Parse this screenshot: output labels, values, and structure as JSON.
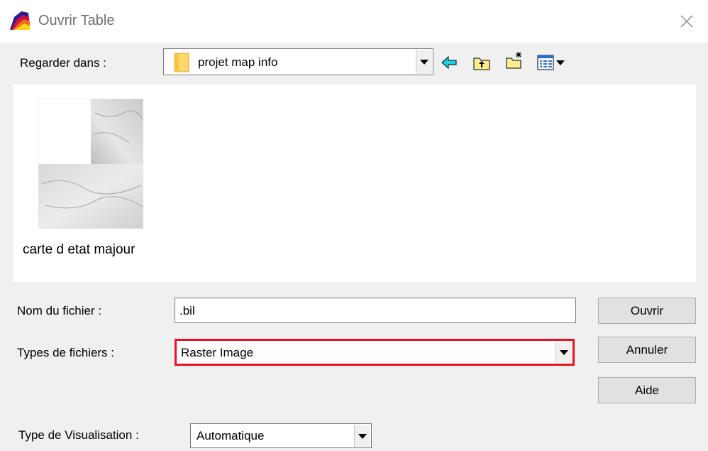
{
  "window": {
    "title": "Ouvrir Table",
    "icon": "mapinfo-app-icon",
    "close_icon": "close-icon"
  },
  "look_in": {
    "label": "Regarder dans :",
    "value": "projet map info",
    "toolbar": [
      "back-arrow-icon",
      "up-folder-icon",
      "new-folder-icon",
      "view-menu-icon"
    ]
  },
  "files": [
    {
      "name": "carte d etat majour",
      "icon": "raster-map-thumbnail"
    }
  ],
  "filename": {
    "label": "Nom du fichier :",
    "value": ".bil"
  },
  "filetype": {
    "label": "Types de fichiers :",
    "value": "Raster Image",
    "highlight_color": "#e81123"
  },
  "view_type": {
    "label": "Type de Visualisation :",
    "value": "Automatique"
  },
  "buttons": {
    "open": "Ouvrir",
    "cancel": "Annuler",
    "help": "Aide"
  }
}
